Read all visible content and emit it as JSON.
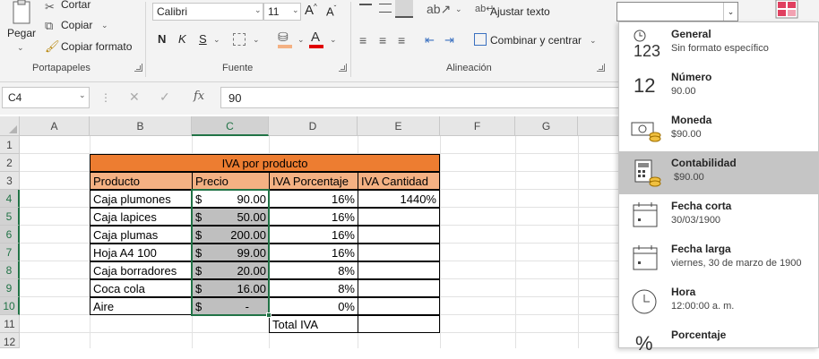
{
  "ribbon": {
    "clipboard": {
      "paste": "Pegar",
      "cut": "Cortar",
      "copy": "Copiar",
      "format_painter": "Copiar formato",
      "label": "Portapapeles"
    },
    "font": {
      "family": "Calibri",
      "size": "11",
      "bold": "N",
      "italic": "K",
      "underline": "S",
      "label": "Fuente"
    },
    "alignment": {
      "wrap_text": "Ajustar texto",
      "merge_center": "Combinar y centrar",
      "label": "Alineación"
    }
  },
  "formula_bar": {
    "name_box": "C4",
    "fx": "fx",
    "value": "90"
  },
  "columns": [
    "A",
    "B",
    "C",
    "D",
    "E",
    "F",
    "G"
  ],
  "rows": [
    "1",
    "2",
    "3",
    "4",
    "5",
    "6",
    "7",
    "8",
    "9",
    "10",
    "11",
    "12"
  ],
  "sheet": {
    "title": "IVA por producto",
    "headers": [
      "Producto",
      "Precio",
      "IVA Porcentaje",
      "IVA Cantidad"
    ],
    "currency": "$",
    "products": [
      {
        "name": "Caja plumones",
        "price": "90.00",
        "pct": "16%",
        "amount": "1440%"
      },
      {
        "name": "Caja lapices",
        "price": "50.00",
        "pct": "16%",
        "amount": ""
      },
      {
        "name": "Caja plumas",
        "price": "200.00",
        "pct": "16%",
        "amount": ""
      },
      {
        "name": "Hoja A4 100",
        "price": "99.00",
        "pct": "16%",
        "amount": ""
      },
      {
        "name": "Caja borradores",
        "price": "20.00",
        "pct": "8%",
        "amount": ""
      },
      {
        "name": "Coca cola",
        "price": "16.00",
        "pct": "8%",
        "amount": ""
      },
      {
        "name": "Aire",
        "price": "-",
        "pct": "0%",
        "amount": ""
      }
    ],
    "total_label": "Total IVA"
  },
  "number_format_menu": {
    "items": [
      {
        "name": "General",
        "example": "Sin formato específico",
        "icon": "general-123-icon"
      },
      {
        "name": "Número",
        "example": "90.00",
        "icon": "number-12-icon"
      },
      {
        "name": "Moneda",
        "example": "$90.00",
        "icon": "currency-icon"
      },
      {
        "name": "Contabilidad",
        "example": " $90.00",
        "icon": "accounting-icon"
      },
      {
        "name": "Fecha corta",
        "example": "30/03/1900",
        "icon": "calendar-icon"
      },
      {
        "name": "Fecha larga",
        "example": "viernes, 30 de marzo de 1900",
        "icon": "calendar-icon"
      },
      {
        "name": "Hora",
        "example": "12:00:00 a. m.",
        "icon": "clock-icon"
      },
      {
        "name": "Porcentaje",
        "example": "",
        "icon": "percent-icon"
      }
    ],
    "icon_text": {
      "general": "123",
      "number": "12",
      "percent": "%"
    }
  }
}
